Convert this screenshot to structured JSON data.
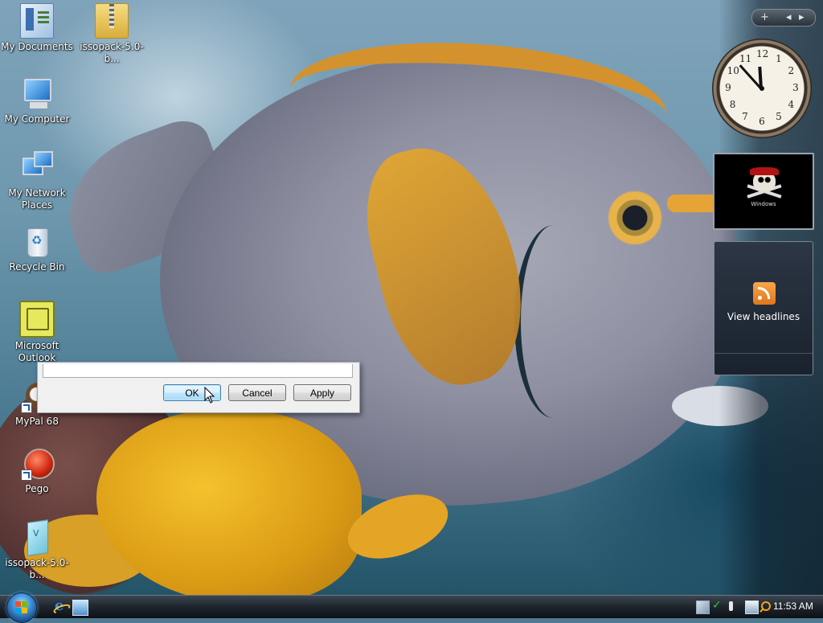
{
  "desktop": {
    "icons": [
      {
        "id": "my-documents",
        "label": "My Documents"
      },
      {
        "id": "zip-file",
        "label": "issopack-5.0-b..."
      },
      {
        "id": "my-computer",
        "label": "My Computer"
      },
      {
        "id": "my-network",
        "label": "My Network Places"
      },
      {
        "id": "recycle-bin",
        "label": "Recycle Bin"
      },
      {
        "id": "outlook",
        "label": "Microsoft Outlook"
      },
      {
        "id": "mypal",
        "label": "MyPal 68"
      },
      {
        "id": "pego",
        "label": "Pego"
      },
      {
        "id": "issopack-disc",
        "label": "issopack-5.0-b..."
      }
    ]
  },
  "sidebar": {
    "controls": {
      "add": "+",
      "prev": "◂",
      "next": "▸"
    },
    "clock": {
      "hour": 11,
      "minute": 53,
      "numerals": [
        "12",
        "1",
        "2",
        "3",
        "4",
        "5",
        "6",
        "7",
        "8",
        "9",
        "10",
        "11"
      ]
    },
    "slideshow": {
      "caption": "Windows"
    },
    "feed": {
      "label": "View headlines",
      "icon": "rss-icon"
    }
  },
  "dialog": {
    "field_value": "",
    "buttons": {
      "ok": "OK",
      "cancel": "Cancel",
      "apply": "Apply"
    }
  },
  "taskbar": {
    "start_icon": "windows-logo-icon",
    "quick_launch": [
      "internet-explorer-icon",
      "show-desktop-icon"
    ],
    "clock": "11:53 AM",
    "colors": {
      "flag_red": "#f25022",
      "flag_green": "#7fba00",
      "flag_blue": "#00a4ef",
      "flag_yellow": "#ffb900"
    }
  }
}
